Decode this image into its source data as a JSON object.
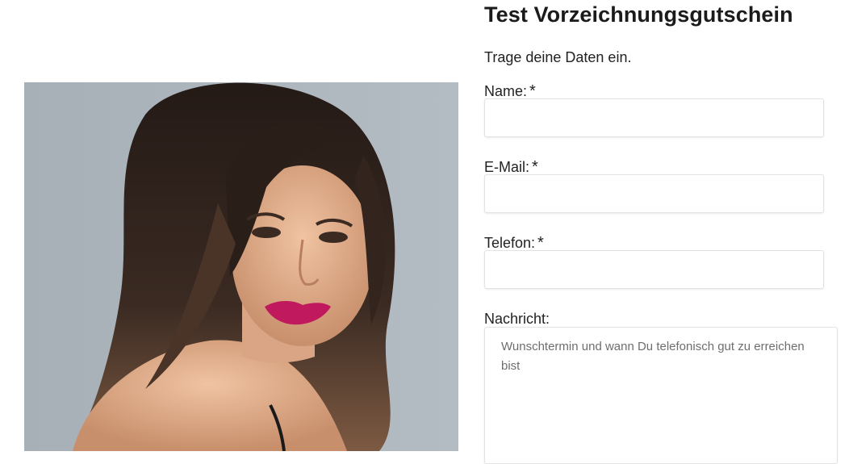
{
  "form": {
    "title": "Test Vorzeichnungsgutschein",
    "intro": "Trage deine Daten ein.",
    "required_marker": "*",
    "name_label": "Name:",
    "name_value": "",
    "email_label": "E-Mail:",
    "email_value": "",
    "phone_label": "Telefon:",
    "phone_value": "",
    "message_label": "Nachricht:",
    "message_placeholder": "Wunschtermin und wann Du telefonisch gut zu erreichen bist"
  },
  "colors": {
    "photo_background": "#aeb6bd",
    "text": "#1c1c1c",
    "field_border": "#e3e3e3"
  }
}
